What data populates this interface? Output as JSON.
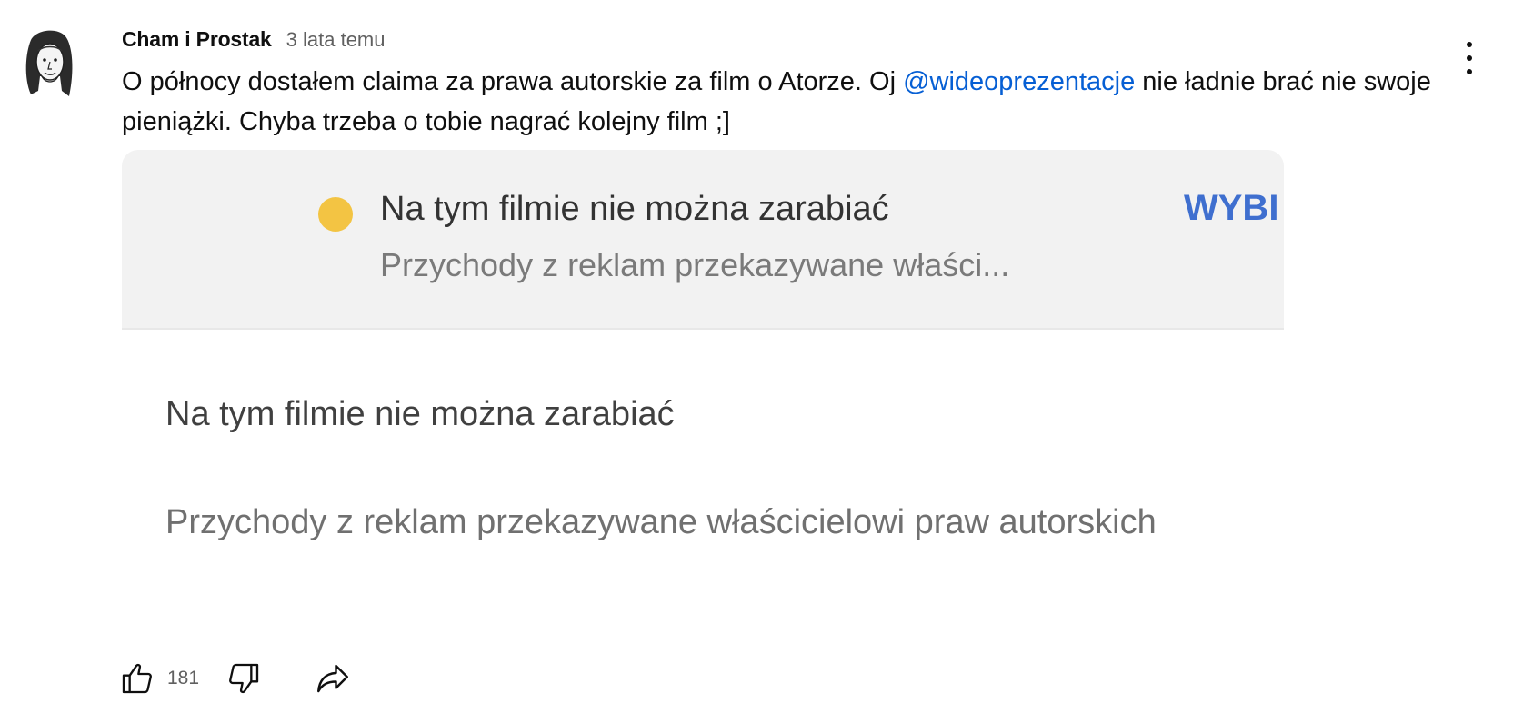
{
  "comment": {
    "author": "Cham i Prostak",
    "timestamp": "3 lata temu",
    "text_before": "O północy dostałem claima za prawa autorskie za film o Atorze. Oj ",
    "mention": "@wideoprezentacje",
    "text_after": " nie ładnie brać nie swoje pieniążki. Chyba trzeba o tobie nagrać kolejny film ;]",
    "like_count": "181"
  },
  "attached_screenshot": {
    "banner_title": "Na tym filmie nie można zarabiać",
    "banner_subtitle": "Przychody z reklam przekazywane właści...",
    "banner_action": "WYBI",
    "detail_title": "Na tym filmie nie można zarabiać",
    "detail_subtitle": "Przychody z reklam przekazywane właścicielowi praw autorskich",
    "status_color": "#f3c443",
    "action_color": "#3f6fcf"
  },
  "icons": {
    "menu": "more-vert-icon",
    "like": "thumb-up-icon",
    "dislike": "thumb-down-icon",
    "share": "share-icon"
  },
  "colors": {
    "mention": "#065fd4",
    "text": "#0f0f0f",
    "secondary": "#606060"
  }
}
